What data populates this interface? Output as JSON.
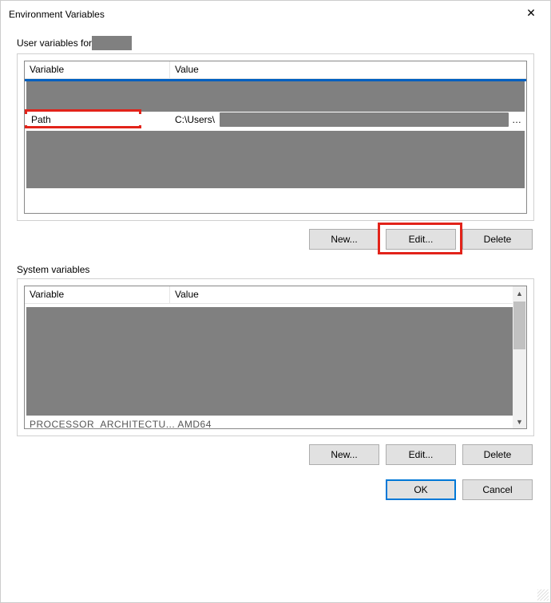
{
  "window": {
    "title": "Environment Variables"
  },
  "user_section": {
    "label_prefix": "User variables for ",
    "columns": {
      "variable": "Variable",
      "value": "Value"
    },
    "path_row": {
      "variable": "Path",
      "value_prefix": "C:\\Users\\",
      "ellipsis": "…"
    },
    "buttons": {
      "new": "New...",
      "edit": "Edit...",
      "del": "Delete"
    }
  },
  "sys_section": {
    "label": "System variables",
    "columns": {
      "variable": "Variable",
      "value": "Value"
    },
    "partial_row": "PROCESSOR_ARCHITECTU...   AMD64",
    "buttons": {
      "new": "New...",
      "edit": "Edit...",
      "del": "Delete"
    }
  },
  "footer": {
    "ok": "OK",
    "cancel": "Cancel"
  }
}
